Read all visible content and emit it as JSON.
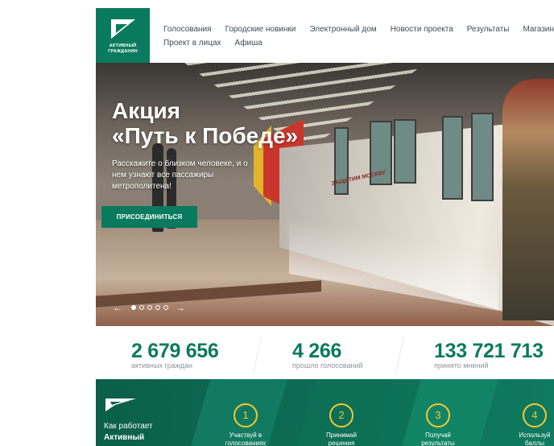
{
  "logo": {
    "line1": "АКТИВНЫЙ",
    "line2": "ГРАЖДАНИН"
  },
  "nav": {
    "row1": [
      "Голосования",
      "Городские новинки",
      "Электронный дом",
      "Новости проекта",
      "Результаты",
      "Магазин поощрений"
    ],
    "row2": [
      "Проект в лицах",
      "Афиша"
    ]
  },
  "hero": {
    "title_line1": "Акция",
    "title_line2": "«Путь к Победе»",
    "subtitle": "Расскажите о близком человеке, и о нем узнают все пассажиры метрополитена!",
    "join_button": "ПРИСОЕДИНИТЬСЯ",
    "banner_text": "ЗАЩИТИМ МОСКВУ",
    "slides_total": 5,
    "slide_active": 1,
    "prev_arrow": "←",
    "next_arrow": "→"
  },
  "stats": [
    {
      "value": "2 679 656",
      "label": "активных граждан"
    },
    {
      "value": "4 266",
      "label": "прошло голосований"
    },
    {
      "value": "133 721 713",
      "label": "принято мнений"
    }
  ],
  "how": {
    "line1": "Как работает",
    "line2": "Активный",
    "steps": [
      {
        "num": "1",
        "label1": "Участвуй в",
        "label2": "голосованиях"
      },
      {
        "num": "2",
        "label1": "Принимай",
        "label2": "решения"
      },
      {
        "num": "3",
        "label1": "Получай",
        "label2": "результаты"
      },
      {
        "num": "4",
        "label1": "Используй",
        "label2": "баллы"
      }
    ]
  },
  "colors": {
    "brand": "#0a7a5e",
    "step_accent": "#f2c830",
    "stat_label": "#8b959c",
    "nav_text": "#3d4b55"
  },
  "icons": {
    "logo": "triangle-logo-icon",
    "plane": "plane-icon",
    "prev": "arrow-left-icon",
    "next": "arrow-right-icon"
  }
}
